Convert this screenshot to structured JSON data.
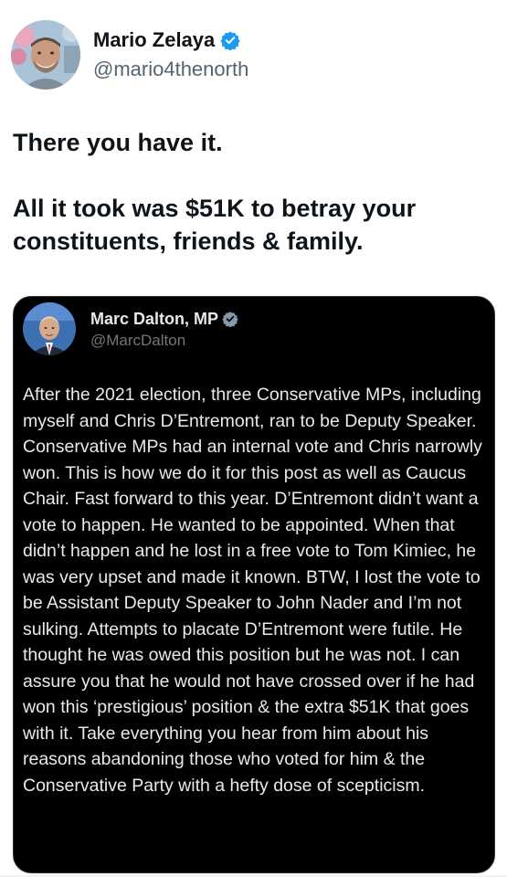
{
  "author": {
    "name": "Mario Zelaya",
    "handle": "@mario4thenorth",
    "verified_icon": "verified-badge-icon",
    "verified_color": "#1d9bf0"
  },
  "tweet": {
    "paragraph_1": "There you have it.",
    "paragraph_2": "All it took was $51K to betray your constituents, friends & family."
  },
  "quoted": {
    "name": "Marc Dalton, MP",
    "handle": "@MarcDalton",
    "verified_icon": "gray-verified-badge-icon",
    "verified_color": "#829aab",
    "text": "After the 2021 election, three Conservative MPs, including myself and Chris D’Entremont, ran to be Deputy Speaker. Conservative MPs had an internal vote and Chris narrowly won. This is how we do it for this post as well as Caucus Chair. Fast forward to this year. D’Entremont didn’t want a vote to happen. He wanted to be appointed. When that didn’t happen and he lost in a free vote to Tom Kimiec, he was very upset and made it known.  BTW, I lost the vote to be Assistant Deputy Speaker to John Nader and I’m not sulking. Attempts to placate D’Entremont were futile. He thought he was owed this position but he was not. I can assure you that he would not have crossed over if he had won this ‘prestigious’ position & the extra  $51K that goes with it. Take everything you hear from him about his reasons abandoning those who voted for him & the Conservative Party with a hefty dose of scepticism."
  },
  "theme": {
    "card_background": "#000000",
    "card_text": "#e7e9ea",
    "muted_text": "#536471"
  }
}
